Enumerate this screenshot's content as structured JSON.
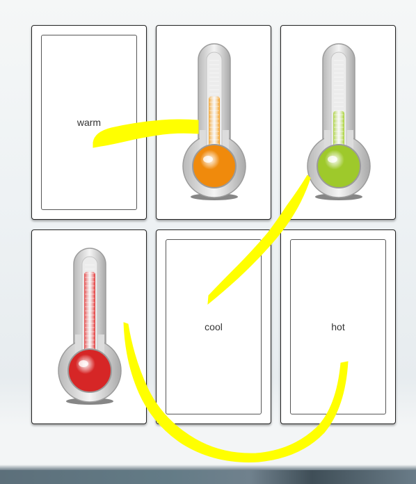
{
  "cards": [
    {
      "kind": "text",
      "label": "warm"
    },
    {
      "kind": "thermometer",
      "level": 0.6,
      "fluid_color": "#f39c1c",
      "bulb_color": "#f08a0c",
      "name": "orange"
    },
    {
      "kind": "thermometer",
      "level": 0.45,
      "fluid_color": "#a4cf2e",
      "bulb_color": "#9ec92b",
      "name": "green"
    },
    {
      "kind": "thermometer",
      "level": 0.9,
      "fluid_color": "#e03030",
      "bulb_color": "#d62626",
      "name": "red"
    },
    {
      "kind": "text",
      "label": "cool"
    },
    {
      "kind": "text",
      "label": "hot"
    }
  ],
  "annotation_color": "#ffff00"
}
